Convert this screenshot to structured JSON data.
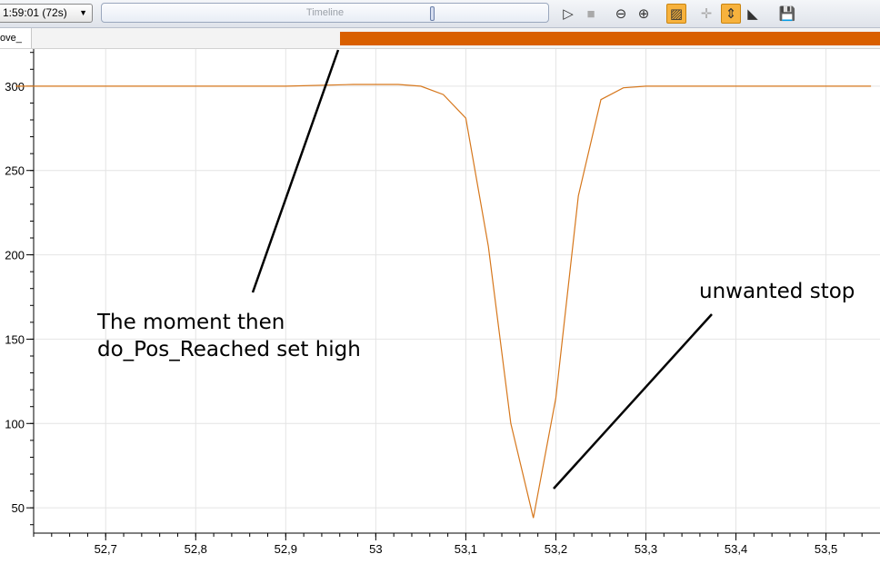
{
  "toolbar": {
    "time_range": "1:59:01 (72s)",
    "timeline_label": "Timeline",
    "icons": [
      {
        "name": "play-icon",
        "glyph": "▷",
        "state": "normal"
      },
      {
        "name": "stop-icon",
        "glyph": "■",
        "state": "disabled"
      },
      {
        "name": "zoom-out-icon",
        "glyph": "⊖",
        "state": "normal"
      },
      {
        "name": "zoom-in-icon",
        "glyph": "⊕",
        "state": "normal"
      },
      {
        "name": "chart-view-icon",
        "glyph": "▨",
        "state": "active"
      },
      {
        "name": "crosshair-icon",
        "glyph": "✛",
        "state": "disabled"
      },
      {
        "name": "vertical-scale-icon",
        "glyph": "⇕",
        "state": "active"
      },
      {
        "name": "cursor-marker-icon",
        "glyph": "◣",
        "state": "normal"
      },
      {
        "name": "save-icon",
        "glyph": "💾",
        "state": "normal"
      }
    ]
  },
  "track": {
    "label": "ove_",
    "bar_color": "#d95f00",
    "high_from_x": 52.96
  },
  "chart_data": {
    "type": "line",
    "x": [
      52.6,
      52.9,
      52.975,
      53.0,
      53.025,
      53.05,
      53.075,
      53.1,
      53.125,
      53.15,
      53.175,
      53.2,
      53.225,
      53.25,
      53.275,
      53.3,
      53.55
    ],
    "series": [
      {
        "values": [
          300,
          300,
          301,
          301,
          301,
          300,
          295,
          281,
          205,
          100,
          44,
          115,
          235,
          292,
          299,
          300,
          300
        ],
        "color": "#d6771c"
      }
    ],
    "xlim": [
      52.62,
      53.56
    ],
    "ylim": [
      35,
      322
    ],
    "x_ticks": [
      "52,7",
      "52,8",
      "52,9",
      "53",
      "53,1",
      "53,2",
      "53,3",
      "53,4",
      "53,5"
    ],
    "x_tick_values": [
      52.7,
      52.8,
      52.9,
      53.0,
      53.1,
      53.2,
      53.3,
      53.4,
      53.5
    ],
    "y_ticks": [
      "300",
      "250",
      "200",
      "150",
      "100",
      "50"
    ],
    "y_tick_values": [
      300,
      250,
      200,
      150,
      100,
      50
    ],
    "grid": true,
    "annotations": [
      {
        "text": [
          "The moment then",
          "do_Pos_Reached set high"
        ]
      },
      {
        "text": [
          "unwanted stop"
        ]
      }
    ]
  }
}
